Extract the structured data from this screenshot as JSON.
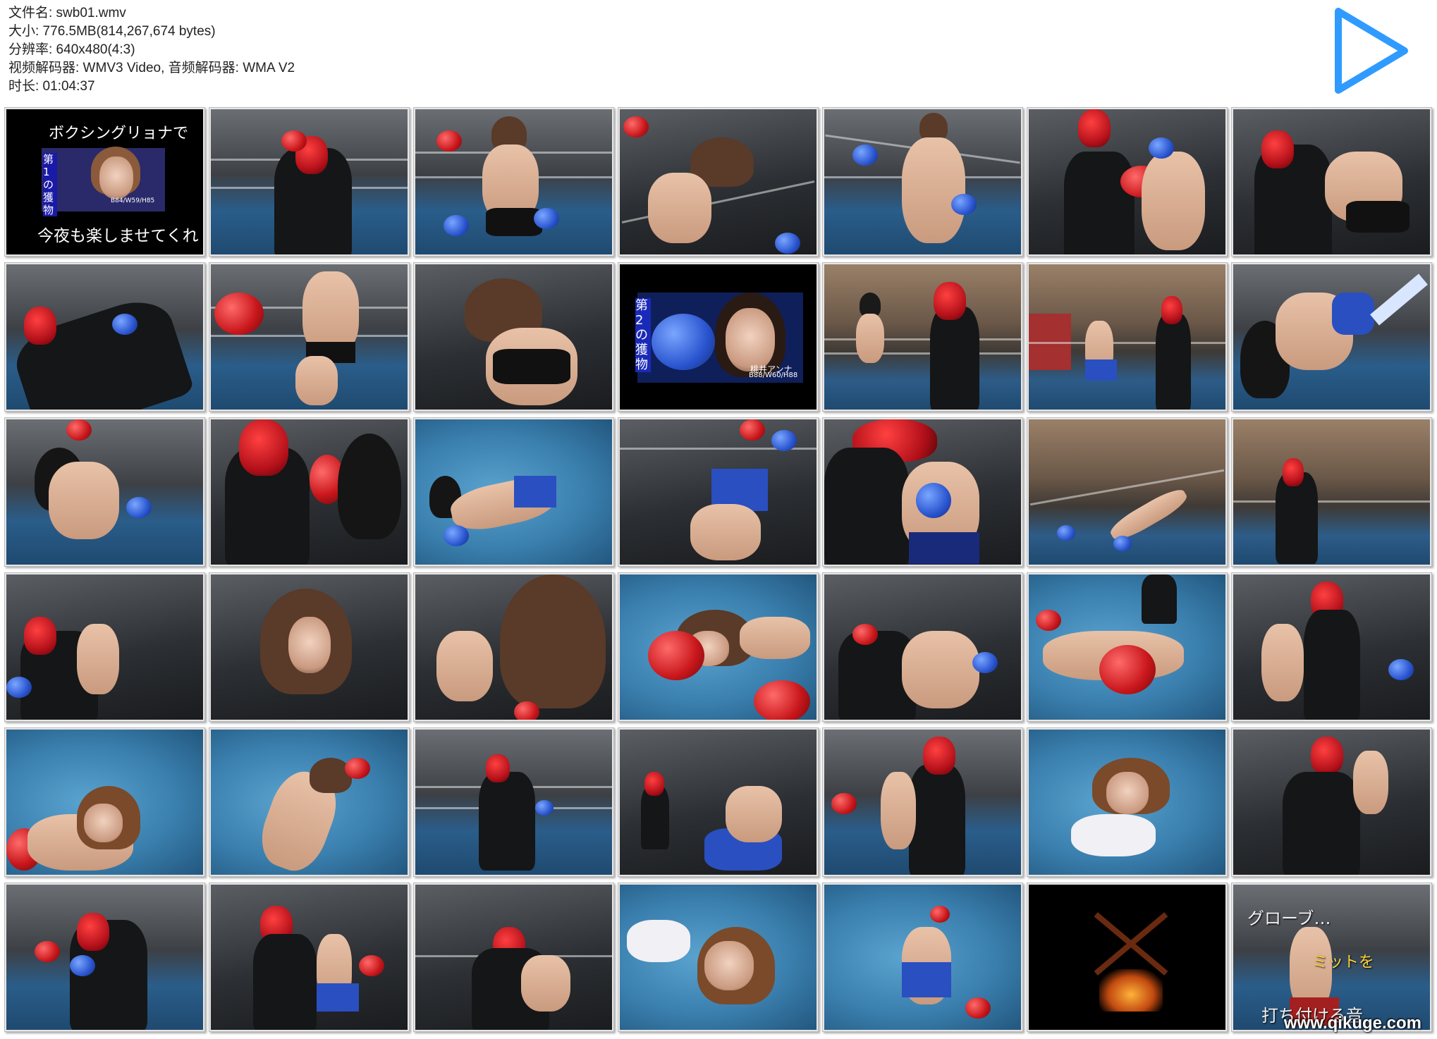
{
  "file_info": {
    "name_line": "文件名: swb01.wmv",
    "size_line": "大小: 776.5MB(814,267,674 bytes)",
    "resolution_line": "分辨率: 640x480(4:3)",
    "codec_line": "视频解码器: WMV3 Video, 音频解码器: WMA V2",
    "duration_line": "时长: 01:04:37"
  },
  "play_icon": {
    "name": "play-icon",
    "color": "#2f9bff"
  },
  "title_card_1": {
    "headline": "ボクシングリョナで",
    "vertical": "第1の獲物",
    "caption": "今夜も楽しませてくれ",
    "stats": "B84/W59/H85"
  },
  "title_card_2": {
    "vertical": "第2の獲物",
    "name": "桃井アンナ",
    "stats": "B88/W60/H88"
  },
  "last_card": {
    "line1": "グローブ…",
    "line2": "ミットを",
    "line3": "打ち付ける音"
  },
  "watermark": "www.qikuge.com",
  "colors": {
    "accent": "#2f9bff",
    "mask_red": "#c8161b",
    "glove_blue": "#2a55d0",
    "mat_blue": "#3a7fae"
  }
}
